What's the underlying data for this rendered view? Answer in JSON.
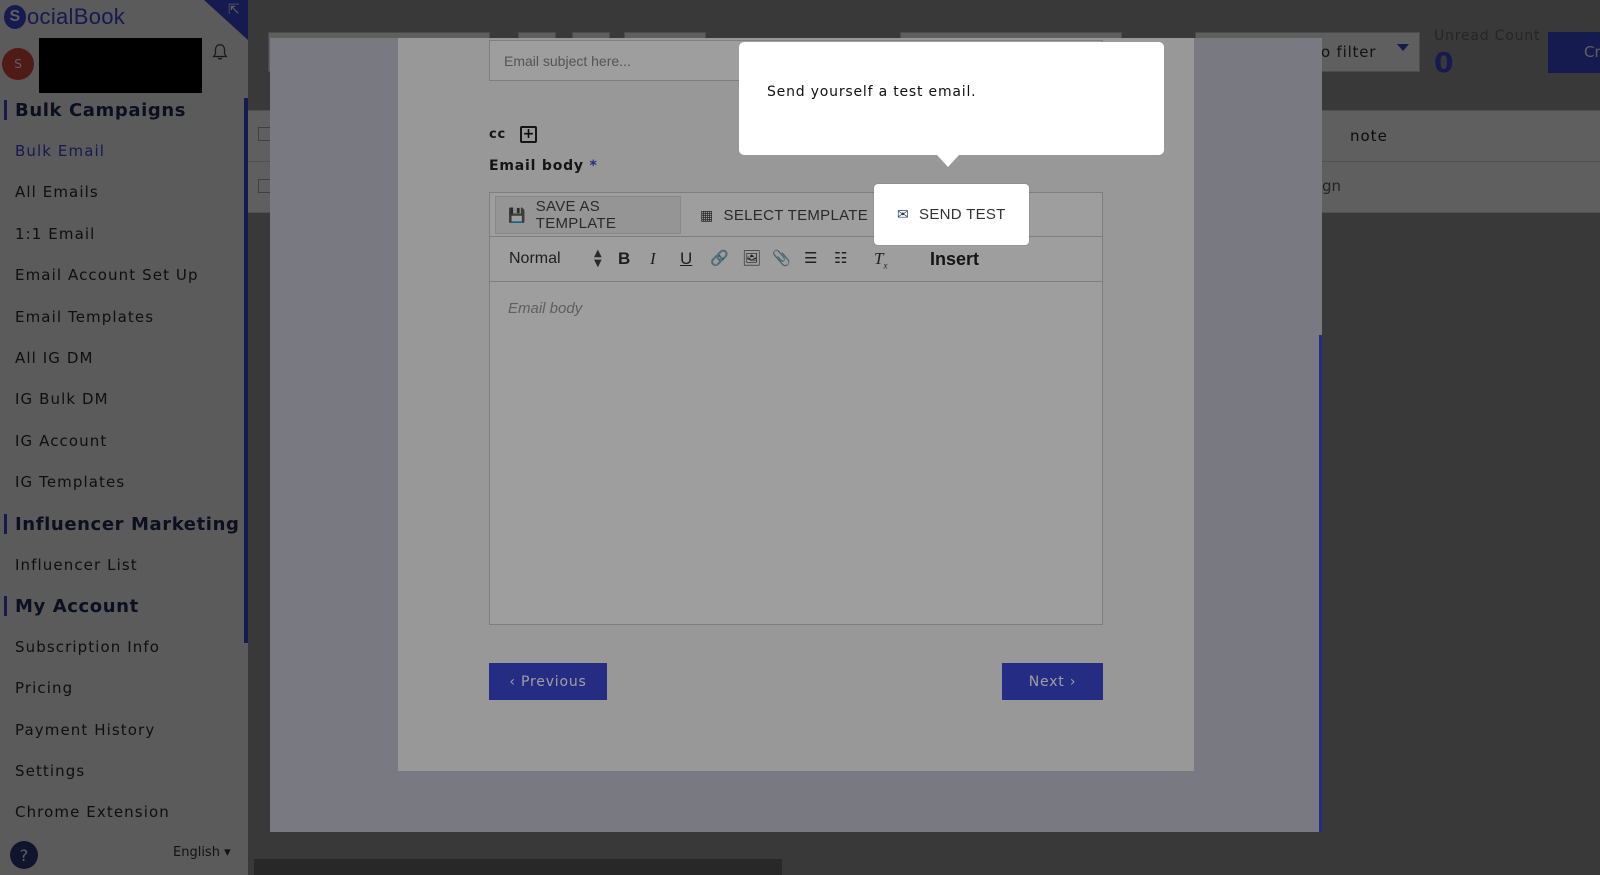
{
  "app": {
    "logo_rest": "ocialBook",
    "logo_initial": "S"
  },
  "user": {
    "avatar_initial": "S"
  },
  "sidebar": {
    "sections": [
      {
        "heading": "Bulk Campaigns",
        "items": [
          "Bulk Email",
          "All Emails",
          "1:1 Email",
          "Email Account Set Up",
          "Email Templates",
          "All IG DM",
          "IG Bulk DM",
          "IG Account",
          "IG Templates"
        ]
      },
      {
        "heading": "Influencer Marketing",
        "items": [
          "Influencer List"
        ]
      },
      {
        "heading": "My Account",
        "items": [
          "Subscription Info",
          "Pricing",
          "Payment History",
          "Settings",
          "Chrome Extension"
        ]
      }
    ],
    "active_item": "Bulk Email",
    "language": "English ▾",
    "help": "?"
  },
  "background": {
    "filter_text": "o filter",
    "unread_label": "Unread Count",
    "unread_value": "0",
    "create_button": "Cr",
    "table_header_note": "note",
    "row_text": "gn"
  },
  "modal": {
    "subject_placeholder": "Email subject here...",
    "cc_label": "cc",
    "body_label": "Email body",
    "required_mark": "*",
    "template_buttons": {
      "save": "SAVE AS TEMPLATE",
      "select": "SELECT TEMPLATE",
      "send_test": "SEND TEST"
    },
    "format_select": "Normal",
    "insert_label": "Insert",
    "body_placeholder": "Email body",
    "prev_button": "‹ Previous",
    "next_button": "Next ›"
  },
  "tour": {
    "tooltip_text": "Send yourself a test email."
  },
  "colors": {
    "accent": "#3a47d5",
    "avatar": "#d9463f"
  }
}
